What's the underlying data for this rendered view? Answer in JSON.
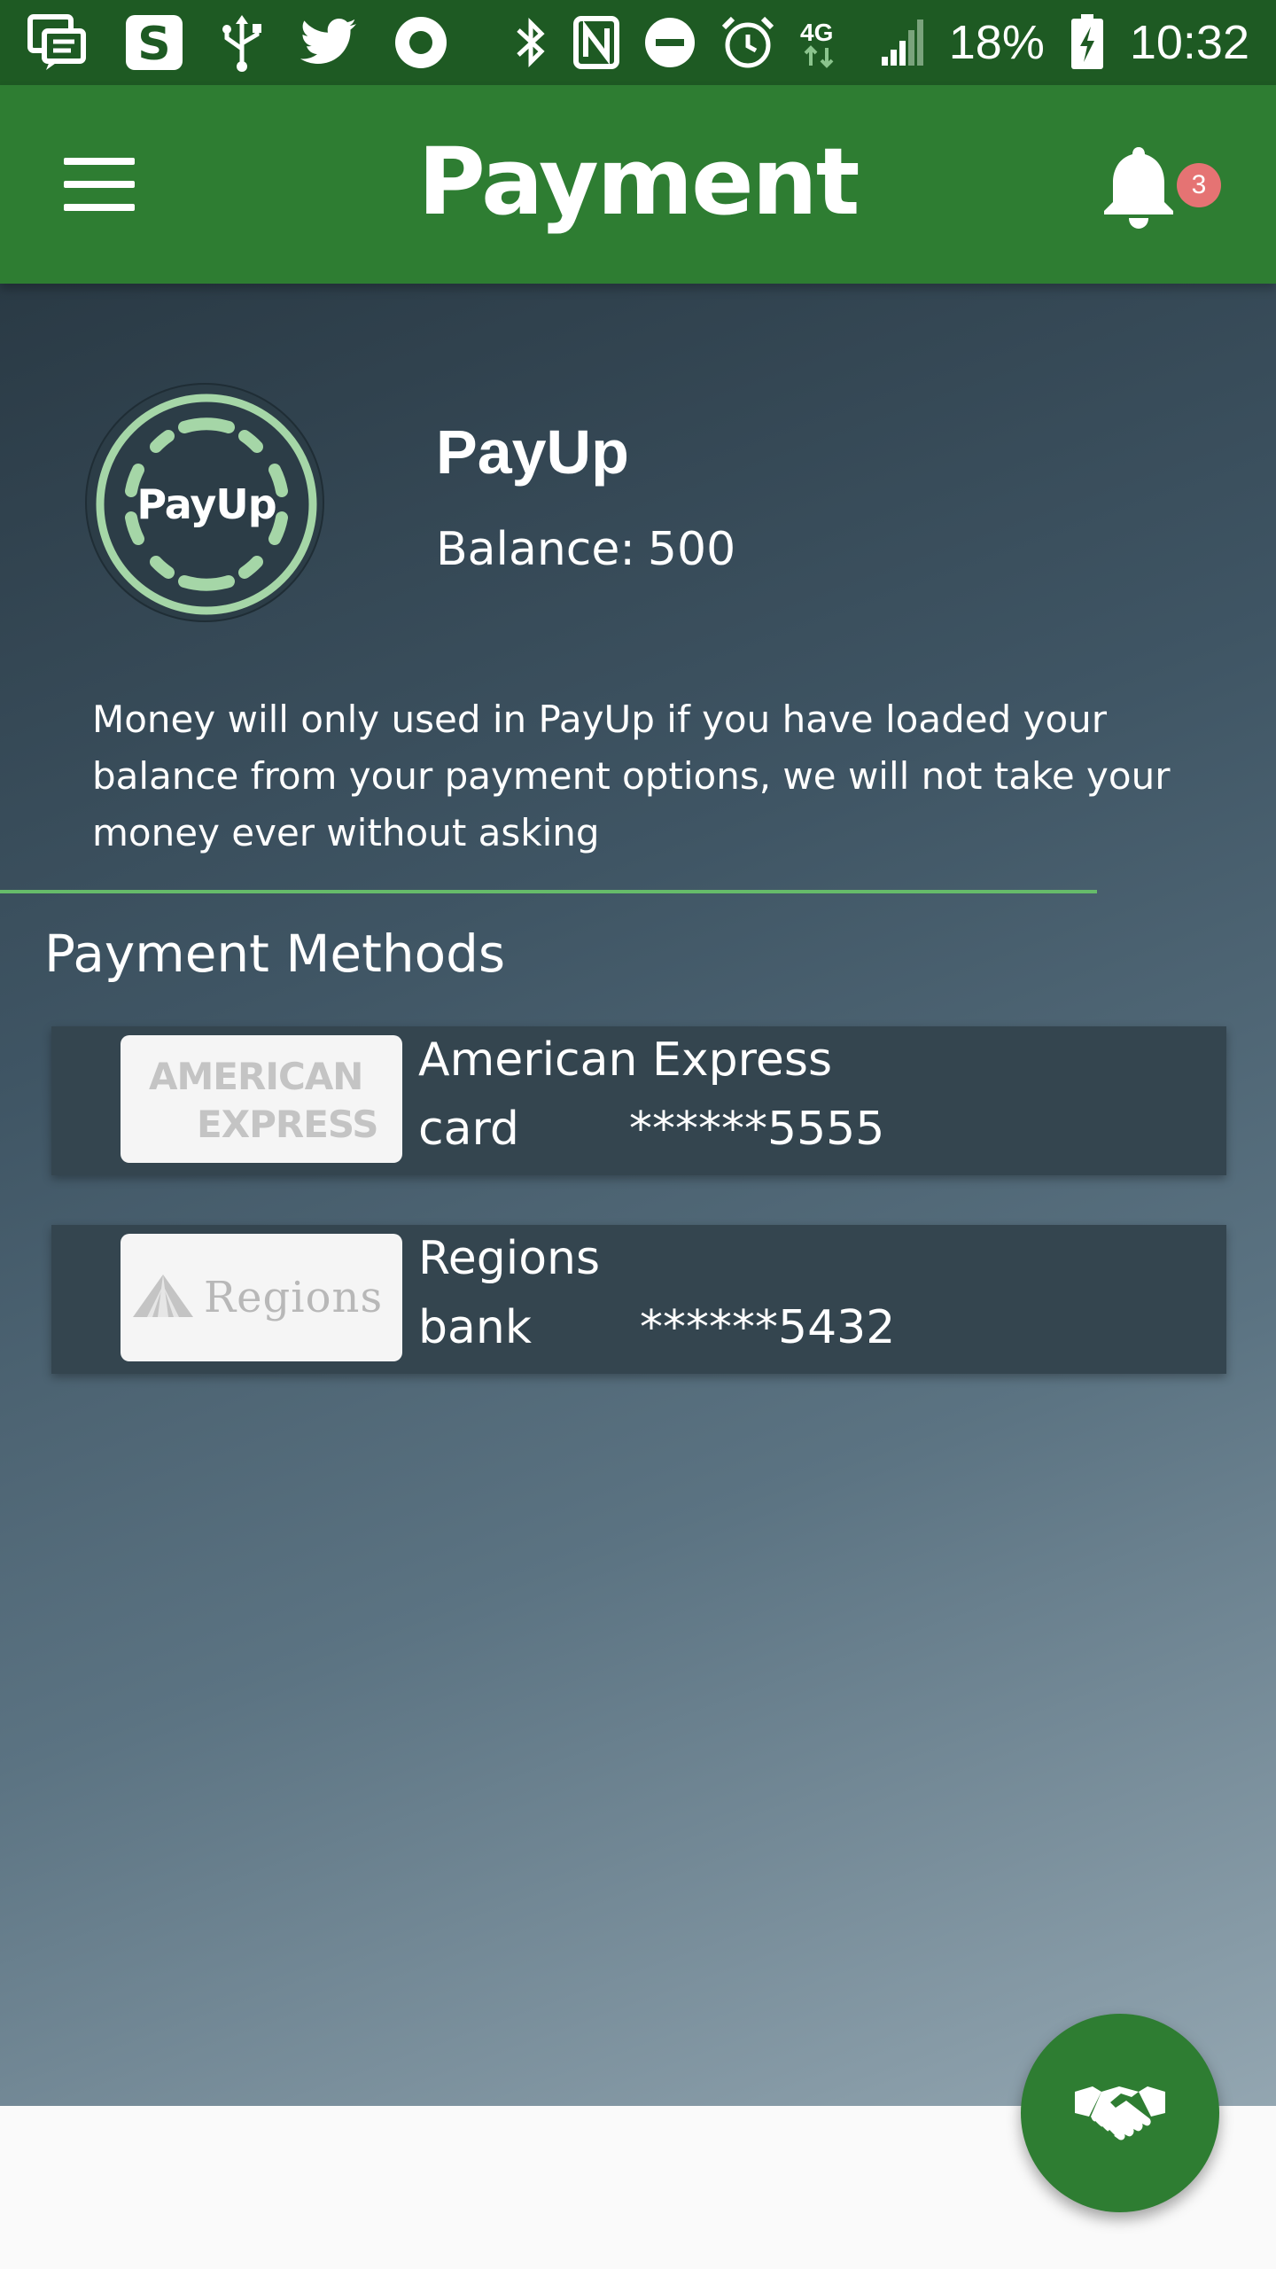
{
  "status_bar": {
    "battery_percent": "18%",
    "time": "10:32",
    "network": "4G"
  },
  "app_bar": {
    "title": "Payment",
    "notification_count": "3"
  },
  "wallet": {
    "logo_text": "PayUp",
    "name": "PayUp",
    "balance_label": "Balance:",
    "balance_value": "500",
    "disclaimer": "Money will only used in PayUp if you have loaded your balance from your payment options, we will not take your money ever without asking"
  },
  "payment_methods": {
    "title": "Payment Methods",
    "items": [
      {
        "logo_line1": "AMERICAN",
        "logo_line2": "EXPRESS",
        "name": "American Express",
        "type": "card",
        "number": "******5555"
      },
      {
        "logo_text": "Regions",
        "name": "Regions",
        "type": "bank",
        "number": "******5432"
      }
    ]
  },
  "colors": {
    "status_bar": "#1e5a23",
    "app_bar": "#2e7d32",
    "accent_green": "#66bb6a",
    "badge": "#e57373"
  },
  "icons": {
    "fab": "handshake-icon",
    "menu": "menu-icon",
    "notifications": "bell-icon"
  }
}
